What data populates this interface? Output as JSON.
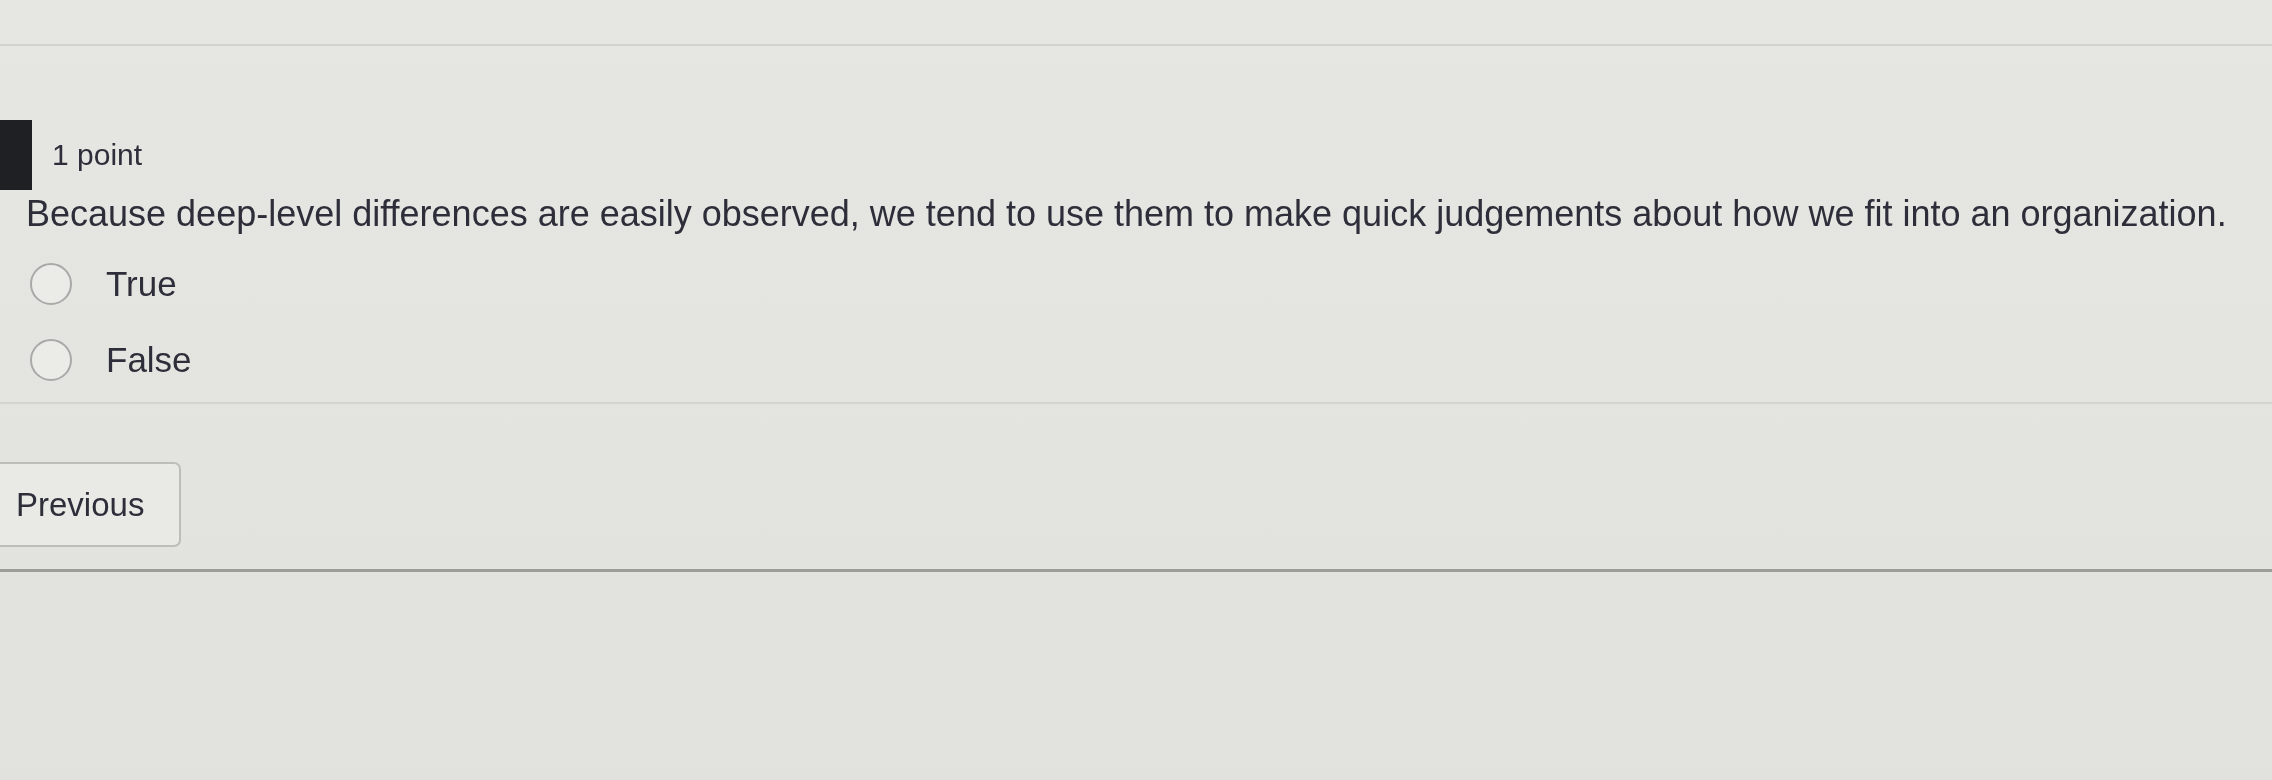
{
  "question": {
    "points": "1 point",
    "text": "Because deep-level differences are easily observed, we tend to use them to make quick judgements about how we fit into an organization.",
    "options": [
      {
        "label": "True",
        "selected": false
      },
      {
        "label": "False",
        "selected": false
      }
    ]
  },
  "navigation": {
    "previous_button": "Previous"
  }
}
